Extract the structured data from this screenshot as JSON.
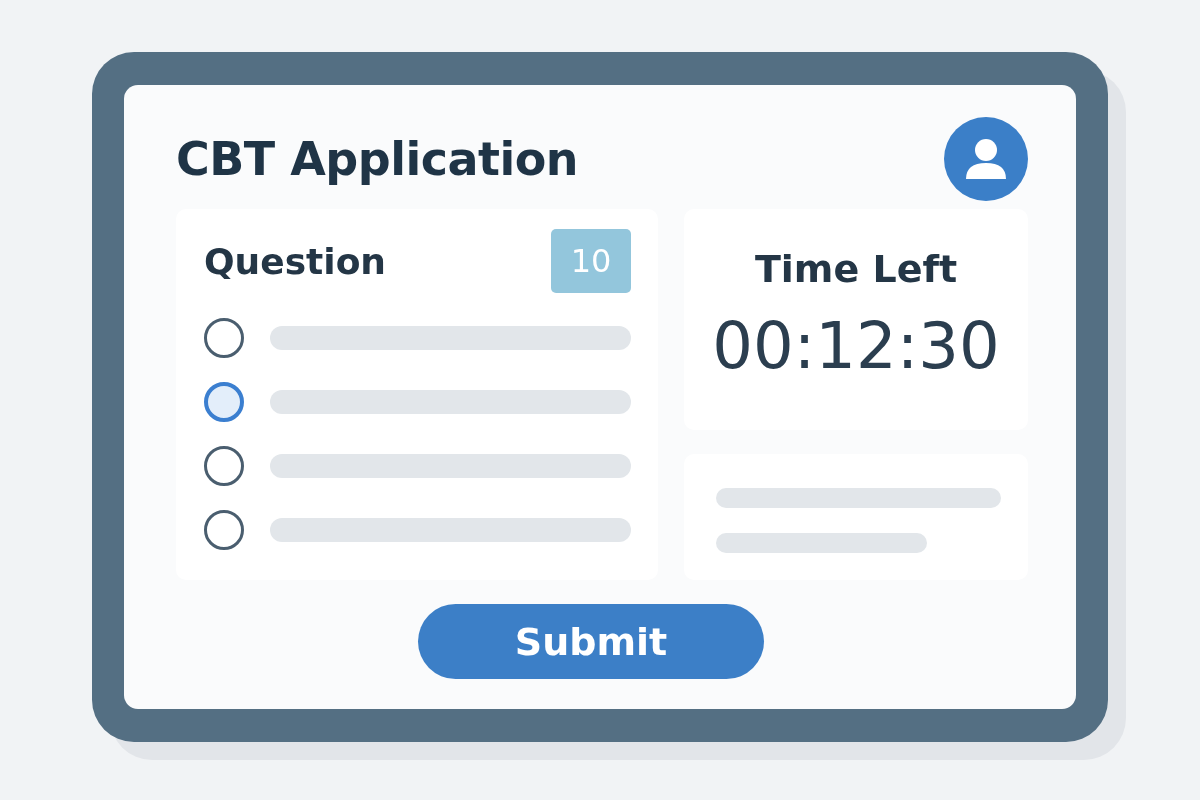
{
  "app": {
    "title": "CBT Application"
  },
  "question": {
    "label": "Question",
    "number": "10",
    "options": [
      {
        "selected": false
      },
      {
        "selected": true
      },
      {
        "selected": false
      },
      {
        "selected": false
      }
    ]
  },
  "timer": {
    "label": "Time Left",
    "value": "00:12:30"
  },
  "submit": {
    "label": "Submit"
  }
}
